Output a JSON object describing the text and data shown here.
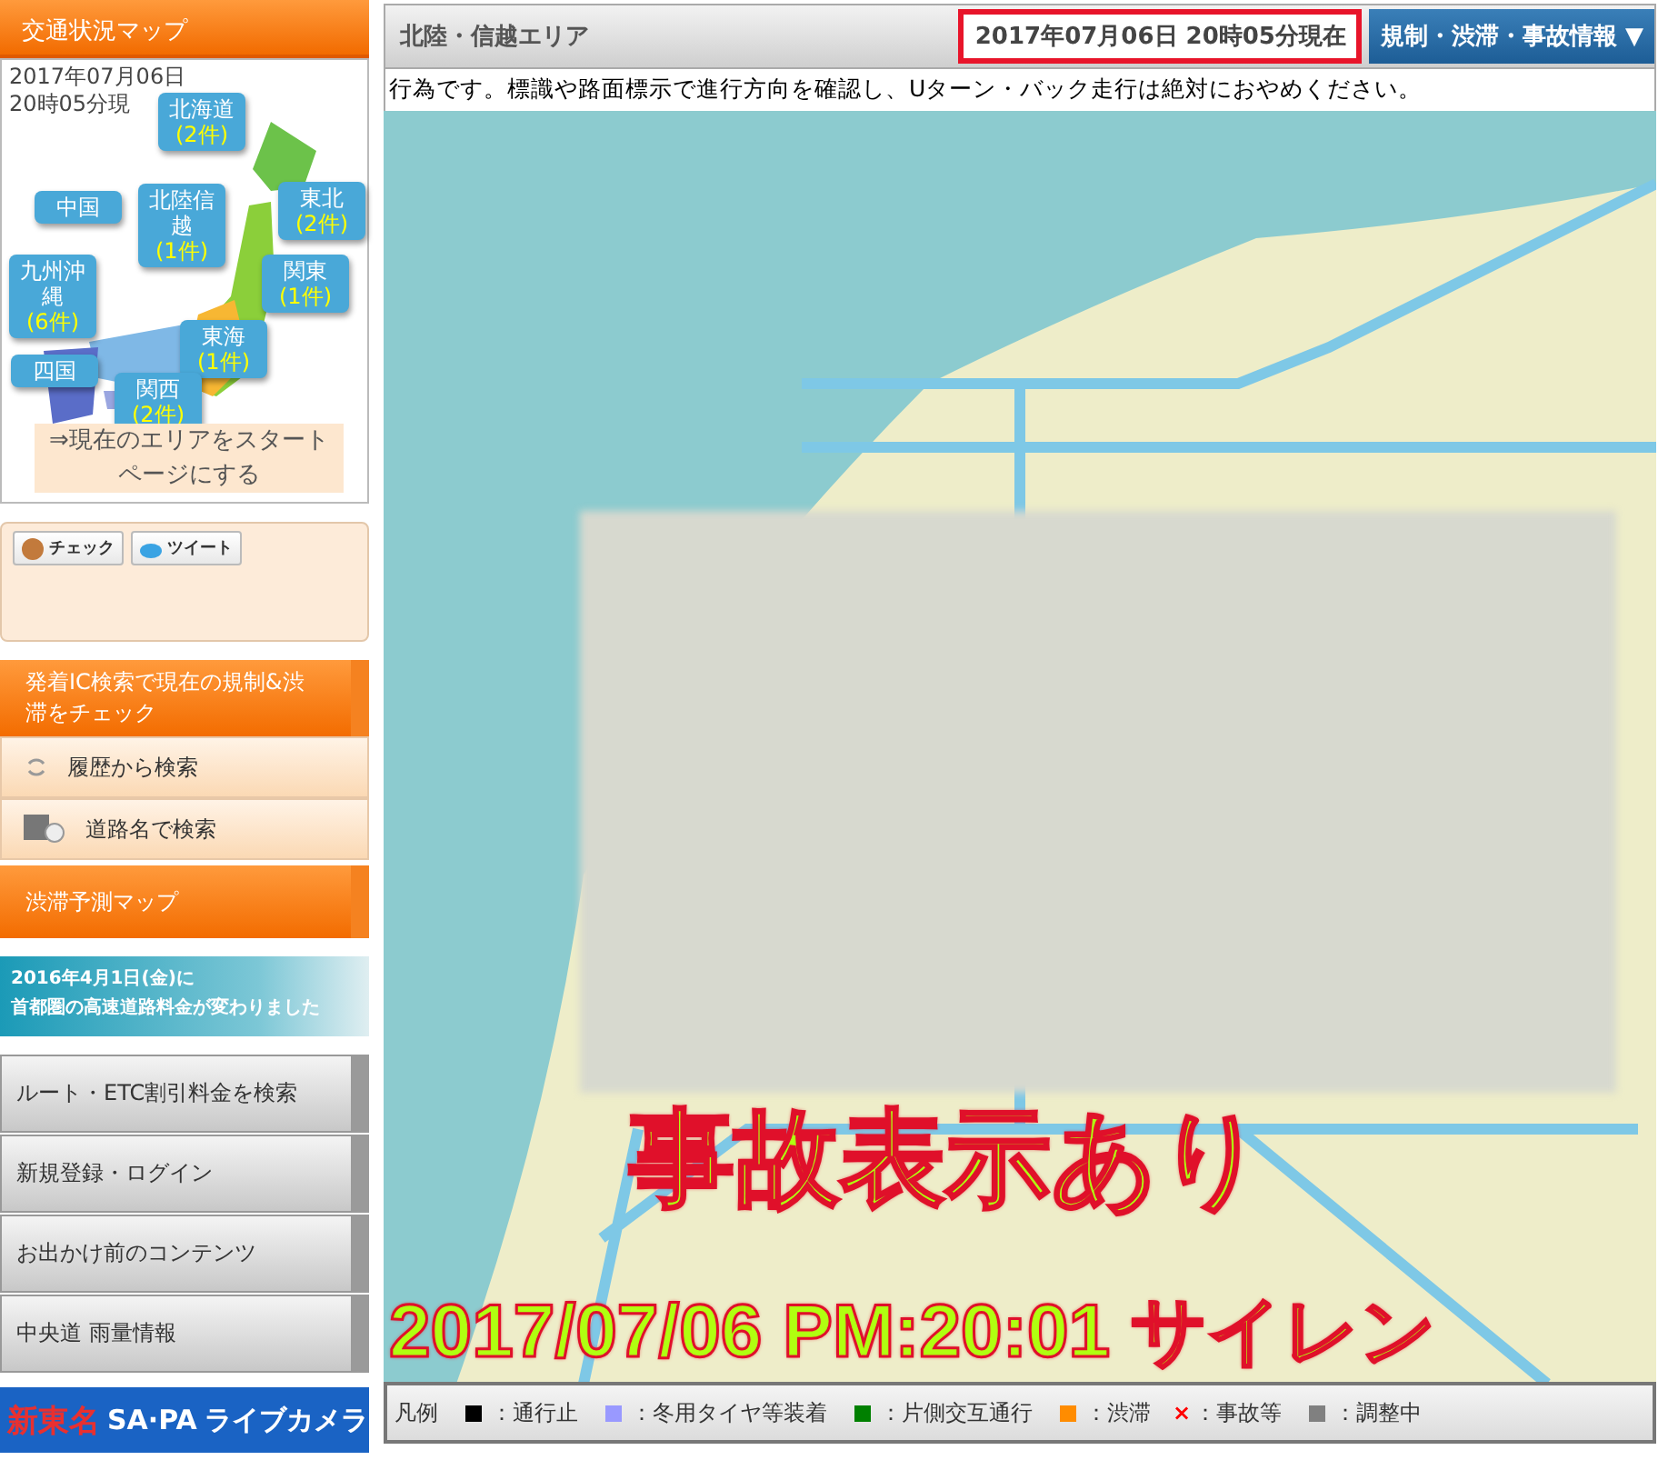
{
  "sidebar": {
    "map_header": "交通状況マップ",
    "map_date": [
      "2017年07月06日",
      "20時05分現"
    ],
    "regions": [
      {
        "name": "北海道",
        "count": "(2件)"
      },
      {
        "name": "中国"
      },
      {
        "name": "北陸信越",
        "count": "(1件)"
      },
      {
        "name": "東北",
        "count": "(2件)"
      },
      {
        "name": "関東",
        "count": "(1件)"
      },
      {
        "name": "九州沖縄",
        "count": "(6件)"
      },
      {
        "name": "東海",
        "count": "(1件)"
      },
      {
        "name": "四国"
      },
      {
        "name": "関西",
        "count": "(2件)"
      }
    ],
    "start_page_link": "⇒現在のエリアをスタートページにする",
    "share_buttons": [
      {
        "kind": "check",
        "label": "チェック"
      },
      {
        "kind": "tweet",
        "label": "ツイート"
      }
    ],
    "search_header": "発着IC検索で現在の規制&渋滞をチェック",
    "search_items": [
      {
        "kind": "history",
        "label": "履歴から検索"
      },
      {
        "kind": "road",
        "label": "道路名で検索"
      }
    ],
    "forecast_button": "渋滞予測マップ",
    "notice_banner": [
      "2016年4月1日(金)に",
      "首都圏の高速道路料金が変わりました"
    ],
    "menu_items": [
      "ルート・ETC割引料金を検索",
      "新規登録・ログイン",
      "お出かけ前のコンテンツ",
      "中央道 雨量情報"
    ],
    "camera_banner": [
      "新東名",
      "SA·PA",
      "ライブカメラ"
    ]
  },
  "main": {
    "area_title": "北陸・信越エリア",
    "timestamp": "2017年07月06日 20時05分現在",
    "info_button": "規制・渋滞・事故情報 ▼",
    "notice": "行為です。標識や路面標示で進行方向を確認し、Uターン・バック走行は絶対におやめください。",
    "legend": {
      "title": "凡例",
      "items": [
        {
          "kind": "square",
          "color": "#000000",
          "label": "：通行止"
        },
        {
          "kind": "square",
          "color": "#9999ff",
          "label": "：冬用タイヤ等装着"
        },
        {
          "kind": "square",
          "color": "#008000",
          "label": "：片側交互通行"
        },
        {
          "kind": "square",
          "color": "#ff8c00",
          "label": "：渋滞"
        },
        {
          "kind": "cross",
          "symbol": "×",
          "color": "#ff0000",
          "label": "：事故等"
        },
        {
          "kind": "square",
          "color": "#808080",
          "label": "：調整中"
        }
      ]
    }
  },
  "overlay": {
    "headline": "事故表示あり",
    "caption": "2017/07/06 PM:20:01 サイレン"
  }
}
